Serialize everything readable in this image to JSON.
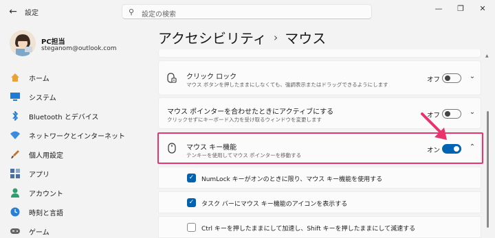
{
  "window": {
    "title": "設定",
    "back_icon": "back-arrow-icon",
    "controls": [
      "minimize-icon",
      "maximize-icon",
      "close-icon"
    ]
  },
  "search": {
    "placeholder": "設定の検索",
    "icon": "search-icon"
  },
  "profile": {
    "name": "PC担当",
    "email": "steganom@outlook.com"
  },
  "sidebar": {
    "items": [
      {
        "label": "ホーム",
        "icon": "home-icon",
        "color": "#e8a23a"
      },
      {
        "label": "システム",
        "icon": "monitor-icon",
        "color": "#1f7ad6"
      },
      {
        "label": "Bluetooth とデバイス",
        "icon": "bluetooth-icon",
        "color": "#1f7ad6"
      },
      {
        "label": "ネットワークとインターネット",
        "icon": "wifi-icon",
        "color": "#3a8be0"
      },
      {
        "label": "個人用設定",
        "icon": "brush-icon",
        "color": "#c0752f"
      },
      {
        "label": "アプリ",
        "icon": "apps-icon",
        "color": "#4a6fa5"
      },
      {
        "label": "アカウント",
        "icon": "account-icon",
        "color": "#2f9e6e"
      },
      {
        "label": "時刻と言語",
        "icon": "globe-clock-icon",
        "color": "#2a7fd4"
      },
      {
        "label": "ゲーム",
        "icon": "gamepad-icon",
        "color": "#666666"
      }
    ]
  },
  "breadcrumb": {
    "parent": "アクセシビリティ",
    "separator": "›",
    "current": "マウス"
  },
  "settings": {
    "click_lock": {
      "title": "クリック ロック",
      "description": "マウス ボタンを押したままにしなくても、強調表示またはドラッグできるようにします",
      "state": "オフ",
      "on": false,
      "icon": "click-lock-icon"
    },
    "active_window": {
      "title": "マウス ポインターを合わせたときにアクティブにする",
      "description": "クリックせずにキーボード入力を受け取るウィンドウを変更します",
      "state": "オフ",
      "on": false
    },
    "mouse_keys": {
      "title": "マウス キー機能",
      "description": "テンキーを使用してマウス ポインターを移動する",
      "state": "オン",
      "on": true,
      "icon": "mouse-icon"
    }
  },
  "options": [
    {
      "label": "NumLock キーがオンのときに限り、マウス キー機能を使用する",
      "checked": true
    },
    {
      "label": "タスク バーにマウス キー機能のアイコンを表示する",
      "checked": true
    },
    {
      "label": "Ctrl キーを押したままにして加速し、Shift キーを押したままにして減速する",
      "checked": false
    }
  ],
  "colors": {
    "accent": "#0063b1",
    "highlight": "#e8336d",
    "arrow": "#e8336d"
  }
}
